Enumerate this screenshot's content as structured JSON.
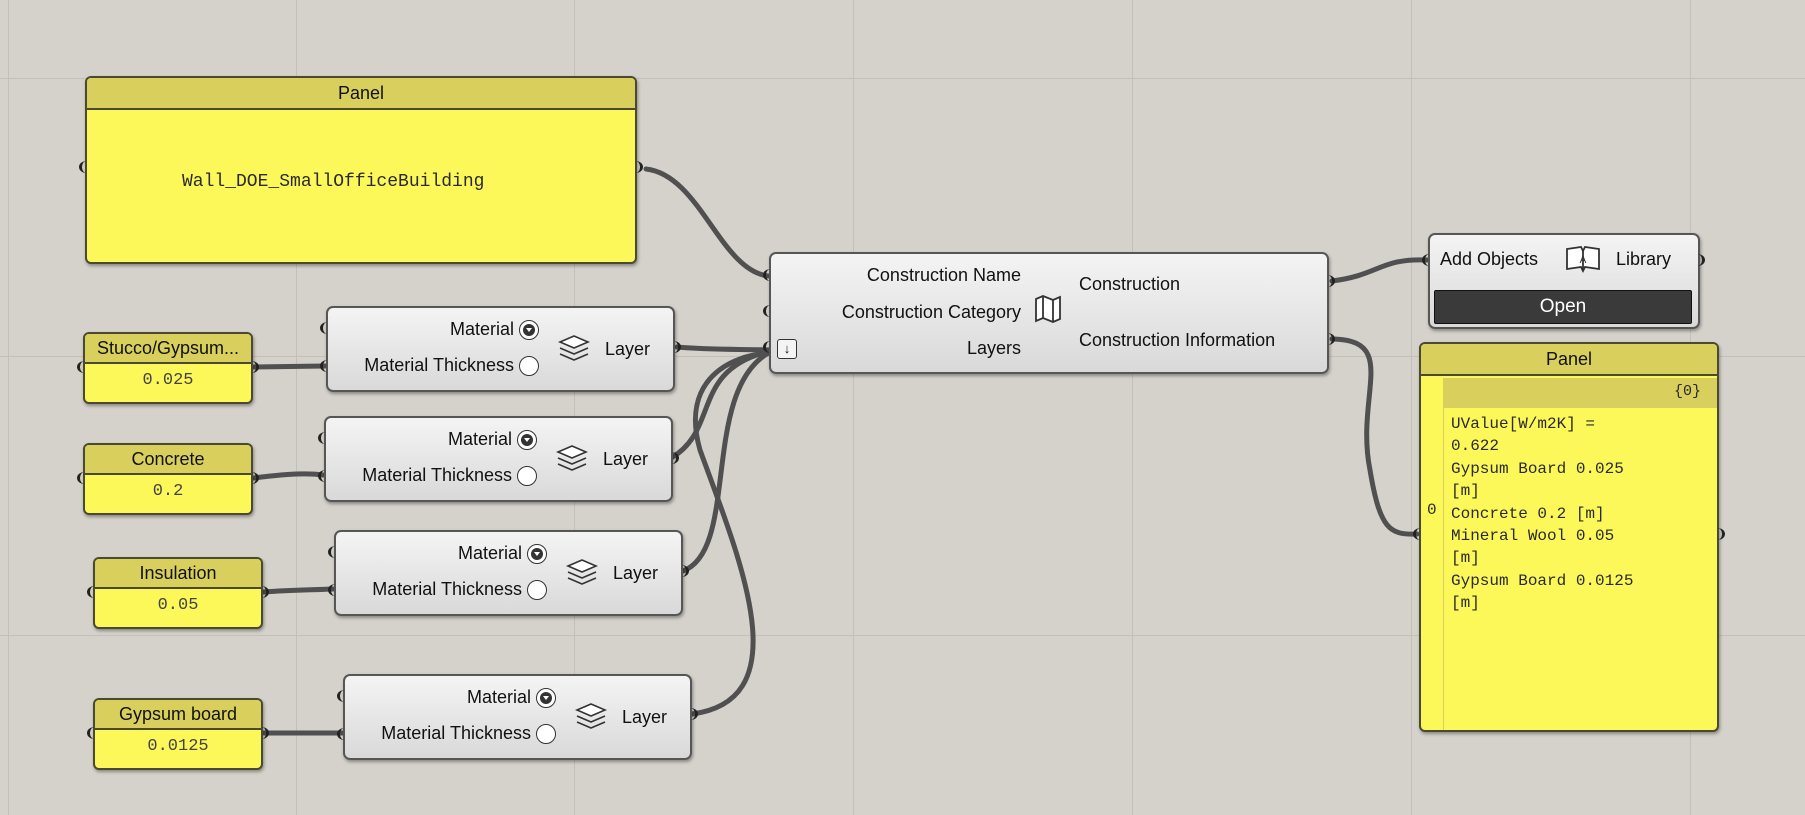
{
  "panel_name_text": {
    "header": "Panel",
    "value": "Wall_DOE_SmallOfficeBuilding"
  },
  "constructor": {
    "inputs": [
      "Construction Name",
      "Construction Category",
      "Layers"
    ],
    "outputs": [
      "Construction",
      "Construction Information"
    ],
    "icon": "map-icon",
    "graft_icon": "arrow-down-icon"
  },
  "add_objects": {
    "input_label": "Add Objects",
    "output_label": "Library",
    "icon": "book-icon",
    "button": "Open"
  },
  "info_panel": {
    "header": "Panel",
    "path": "{0}",
    "index": "0",
    "lines": [
      "UValue[W/m2K] =",
      "0.622",
      "Gypsum Board 0.025",
      "[m]",
      "Concrete 0.2 [m]",
      "Mineral Wool 0.05",
      "[m]",
      "Gypsum Board 0.0125",
      "[m]"
    ]
  },
  "materials": [
    {
      "name": "Stucco/Gypsum...",
      "thickness": "0.025"
    },
    {
      "name": "Concrete",
      "thickness": "0.2"
    },
    {
      "name": "Insulation",
      "thickness": "0.05"
    },
    {
      "name": "Gypsum board",
      "thickness": "0.0125"
    }
  ],
  "layer_component": {
    "input_material": "Material",
    "input_thickness": "Material Thickness",
    "output": "Layer",
    "icon": "layers-icon"
  }
}
